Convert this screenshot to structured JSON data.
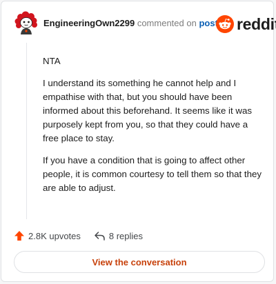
{
  "header": {
    "username": "EngineeringOwn2299",
    "commented_text": "commented on",
    "post_link": "post",
    "brand": "reddit"
  },
  "comment": {
    "paragraphs": [
      "NTA",
      "I understand its something he cannot help and I empathise with that, but you should have been informed about this beforehand. It seems like it was purposely kept from you, so that they could have a free place to stay.",
      "If you have a condition that is going to affect other people, it is common courtesy to tell them so that they are able to adjust."
    ]
  },
  "actions": {
    "upvotes": "2.8K upvotes",
    "replies": "8 replies",
    "upvote_icon": "upvote-arrow-icon",
    "reply_icon": "reply-arrow-icon"
  },
  "cta": {
    "label": "View the conversation"
  },
  "colors": {
    "brand_orange": "#ff4500",
    "link_blue": "#0b5fb4",
    "cta_text": "#c7410b"
  }
}
